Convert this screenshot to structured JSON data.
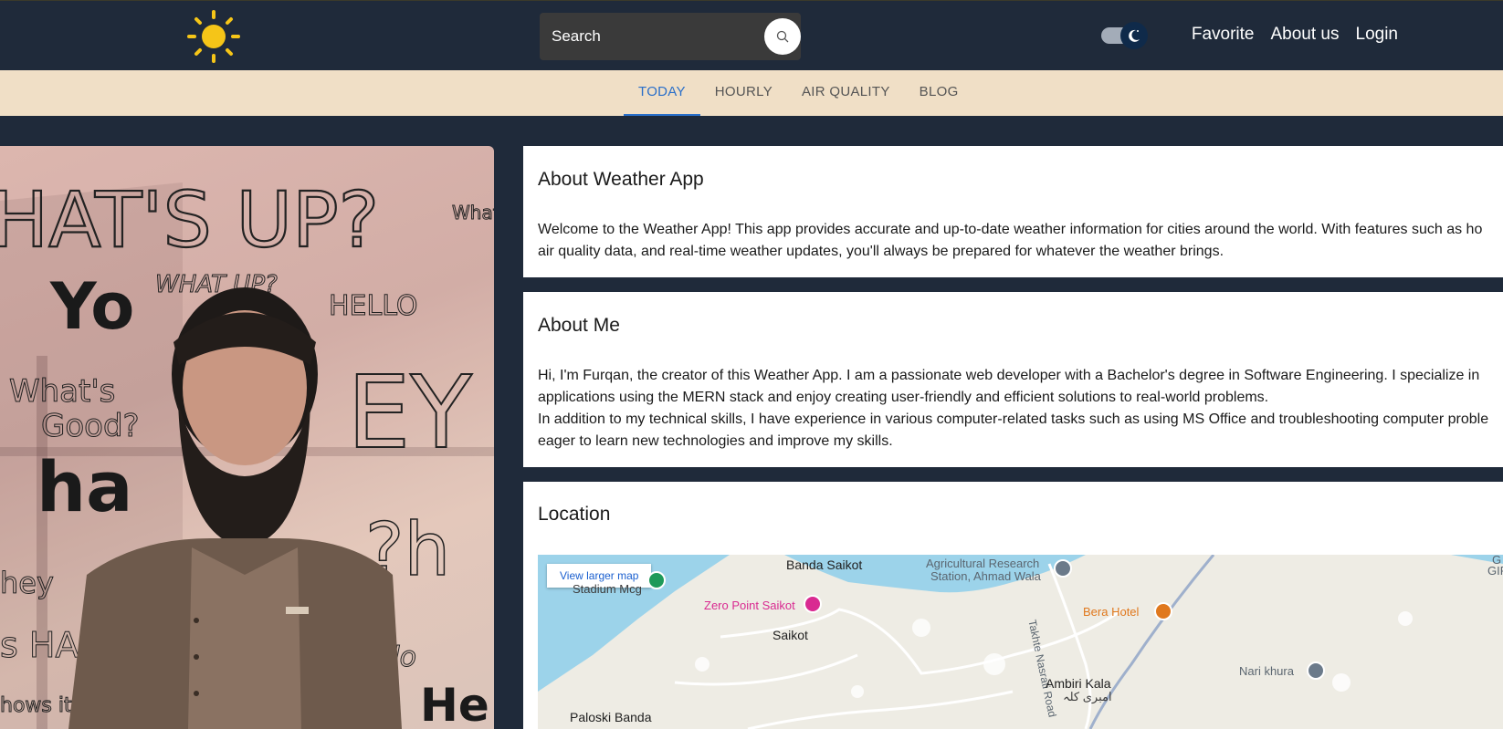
{
  "navbar": {
    "logo": "sun-logo",
    "search_placeholder": "Search",
    "theme_toggle_icon": "moon-icon",
    "links": [
      "Favorite",
      "About us",
      "Login"
    ]
  },
  "tabs": {
    "items": [
      "TODAY",
      "HOURLY",
      "AIR QUALITY",
      "BLOG"
    ],
    "active": "TODAY"
  },
  "about_app": {
    "title": "About Weather App",
    "lines": [
      "Welcome to the Weather App! This app provides accurate and up-to-date weather information for cities around the world. With features such as ho",
      "air quality data, and real-time weather updates, you'll always be prepared for whatever the weather brings."
    ]
  },
  "about_me": {
    "title": "About Me",
    "lines": [
      "Hi, I'm Furqan, the creator of this Weather App. I am a passionate web developer with a Bachelor's degree in Software Engineering. I specialize in",
      "applications using the MERN stack and enjoy creating user-friendly and efficient solutions to real-world problems.",
      "In addition to my technical skills, I have experience in various computer-related tasks such as using MS Office and troubleshooting computer proble",
      "eager to learn new technologies and improve my skills."
    ]
  },
  "location": {
    "title": "Location",
    "map_button": "View larger map",
    "places": {
      "banda_saikot_top": "Banda Saikot",
      "stadium": "Stadium Mcg",
      "zero_point": "Zero Point Saikot",
      "saikot": "Saikot",
      "agri1": "Agricultural Research",
      "agri2": "Station, Ahmad Wala",
      "road": "Takhte Nasrati Road",
      "bera": "Bera Hotel",
      "nari": "Nari khura",
      "ambiri": "Ambiri Kala",
      "ambiri_urdu": "امبری کلہ",
      "paloski": "Paloski Banda",
      "corner1": "G",
      "corner2": "GIF"
    }
  },
  "photo": {
    "alt": "profile-photo"
  },
  "colors": {
    "navbar_bg": "#1f2a3a",
    "tabbar_bg": "#f0dfc6",
    "accent": "#2a6fc9",
    "sun": "#f5c518"
  }
}
